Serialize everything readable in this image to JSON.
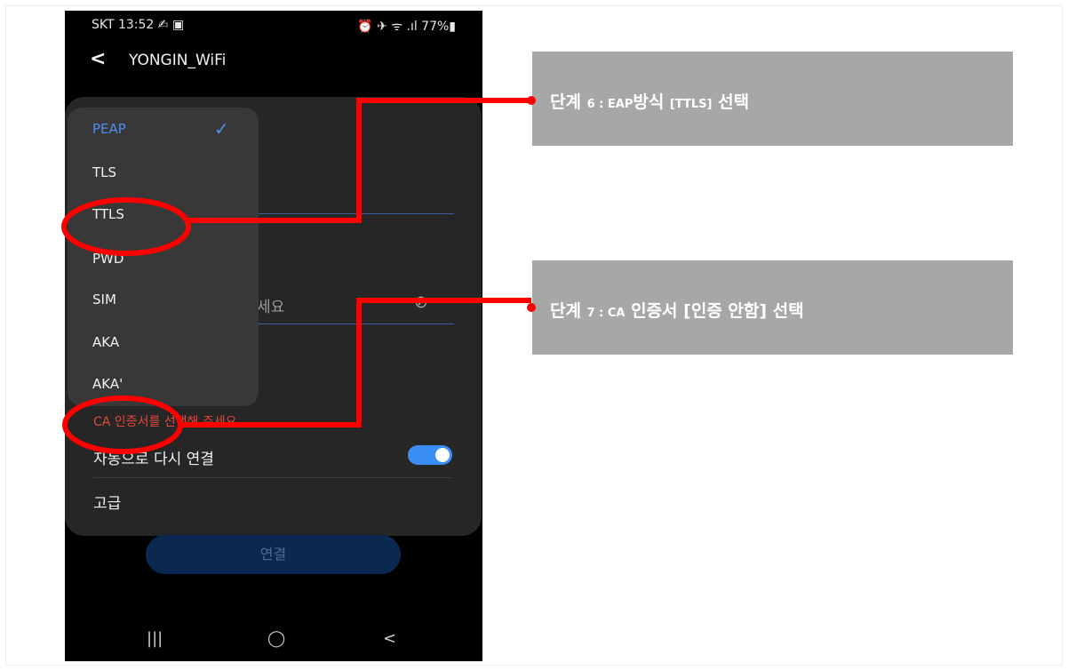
{
  "status_bar": {
    "left": "SKT 13:52 ✍ ▣",
    "right": "⏰ ✈ ᯤ .ıl 77%▮"
  },
  "app_bar": {
    "back_icon": "chevron-left-icon",
    "title": "YONGIN_WiFi"
  },
  "eap_dropdown": {
    "items": [
      {
        "label": "PEAP",
        "selected": true
      },
      {
        "label": "TLS",
        "selected": false
      },
      {
        "label": "TTLS",
        "selected": false
      },
      {
        "label": "PWD",
        "selected": false
      },
      {
        "label": "SIM",
        "selected": false
      },
      {
        "label": "AKA",
        "selected": false
      },
      {
        "label": "AKA'",
        "selected": false
      }
    ]
  },
  "form": {
    "password_placeholder_fragment": "세요",
    "ca_cert_error": "CA 인증서를 선택해 주세요",
    "auto_reconnect_label": "자동으로 다시 연결",
    "auto_reconnect_on": true,
    "advanced_label": "고급",
    "connect_button": "연결"
  },
  "nav_bar": {
    "recents": "|||",
    "home": "◯",
    "back": "<"
  },
  "callouts": [
    {
      "prefix": "단계 ",
      "step": "6 : EAP",
      "rest": "방식 ",
      "bracket": "[TTLS]",
      "end": " 선택"
    },
    {
      "prefix": "단계 ",
      "step": "7 : CA",
      "rest": " 인증서 [인증 안함] 선택"
    }
  ],
  "colors": {
    "highlight": "#ff0000",
    "accent": "#4a8ff0",
    "callout_bg": "#a7a7a7"
  }
}
